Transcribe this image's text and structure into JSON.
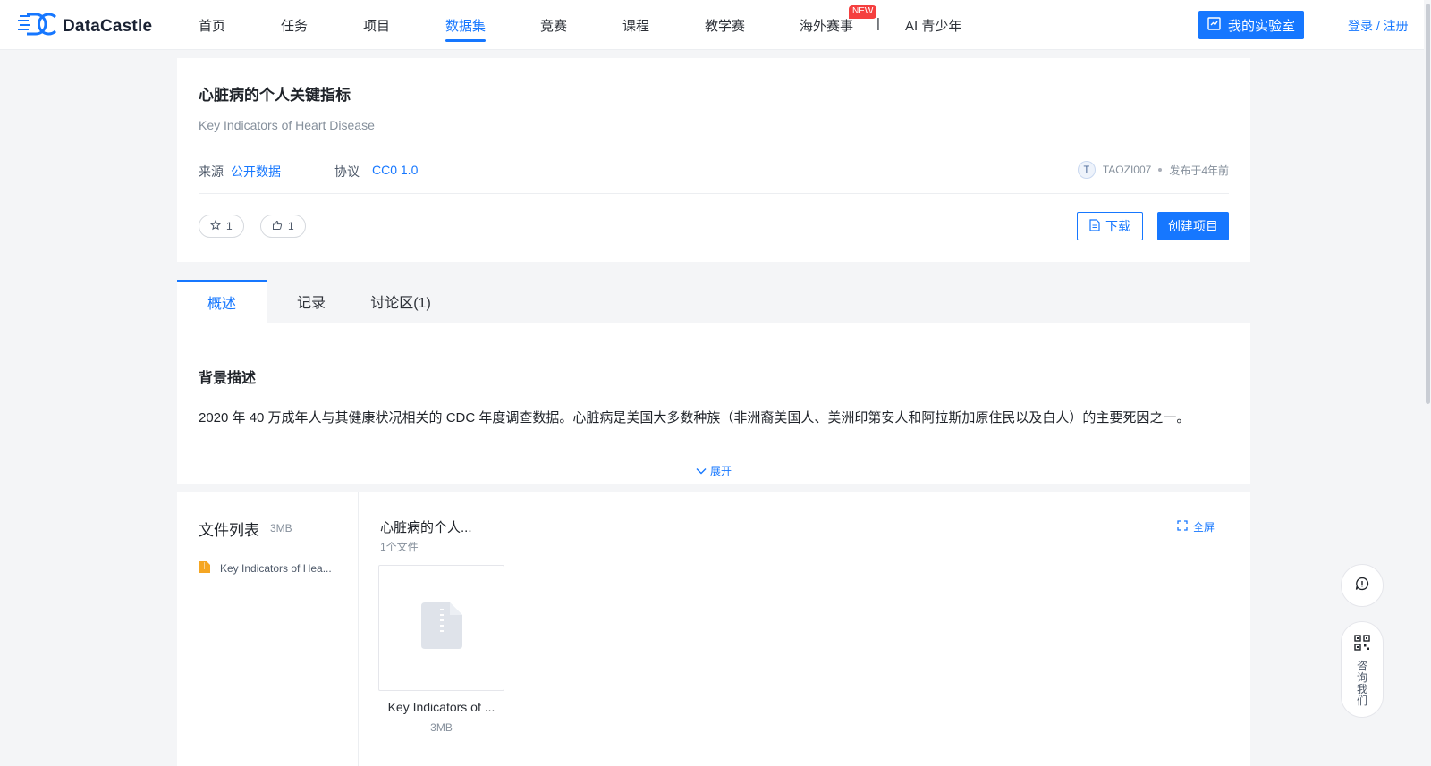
{
  "brand": {
    "name": "DataCastle"
  },
  "nav": {
    "items": [
      "首页",
      "任务",
      "项目",
      "数据集",
      "竞赛",
      "课程",
      "教学赛",
      "海外赛事",
      "AI 青少年"
    ],
    "active": "数据集",
    "new_badge": "NEW",
    "separator": "|"
  },
  "header": {
    "lab_button": "我的实验室",
    "login": "登录 / 注册"
  },
  "dataset": {
    "title_cn": "心脏病的个人关键指标",
    "title_en": "Key Indicators of Heart Disease",
    "source_label": "来源",
    "source_value": "公开数据",
    "license_label": "协议",
    "license_value": "CC0 1.0",
    "author_initial": "T",
    "author": "TAOZI007",
    "published": "发布于4年前",
    "stars": "1",
    "likes": "1",
    "download_label": "下载",
    "create_project_label": "创建项目"
  },
  "tabs": [
    "概述",
    "记录",
    "讨论区(1)"
  ],
  "overview": {
    "heading": "背景描述",
    "body": "2020 年 40 万成年人与其健康状况相关的 CDC 年度调查数据。心脏病是美国大多数种族（非洲裔美国人、美洲印第安人和阿拉斯加原住民以及白人）的主要死因之一。",
    "expand": "展开"
  },
  "files": {
    "title": "文件列表",
    "total_size": "3MB",
    "items": [
      {
        "name": "Key Indicators of Hea..."
      }
    ],
    "folder_name": "心脏病的个人...",
    "folder_count": "1个文件",
    "fullscreen": "全屏",
    "thumb_name": "Key Indicators of ...",
    "thumb_size": "3MB"
  },
  "floating": {
    "consult": "咨询我们"
  },
  "colors": {
    "accent": "#1677ff",
    "badge": "#f53f3f",
    "background": "#f4f5f7"
  }
}
